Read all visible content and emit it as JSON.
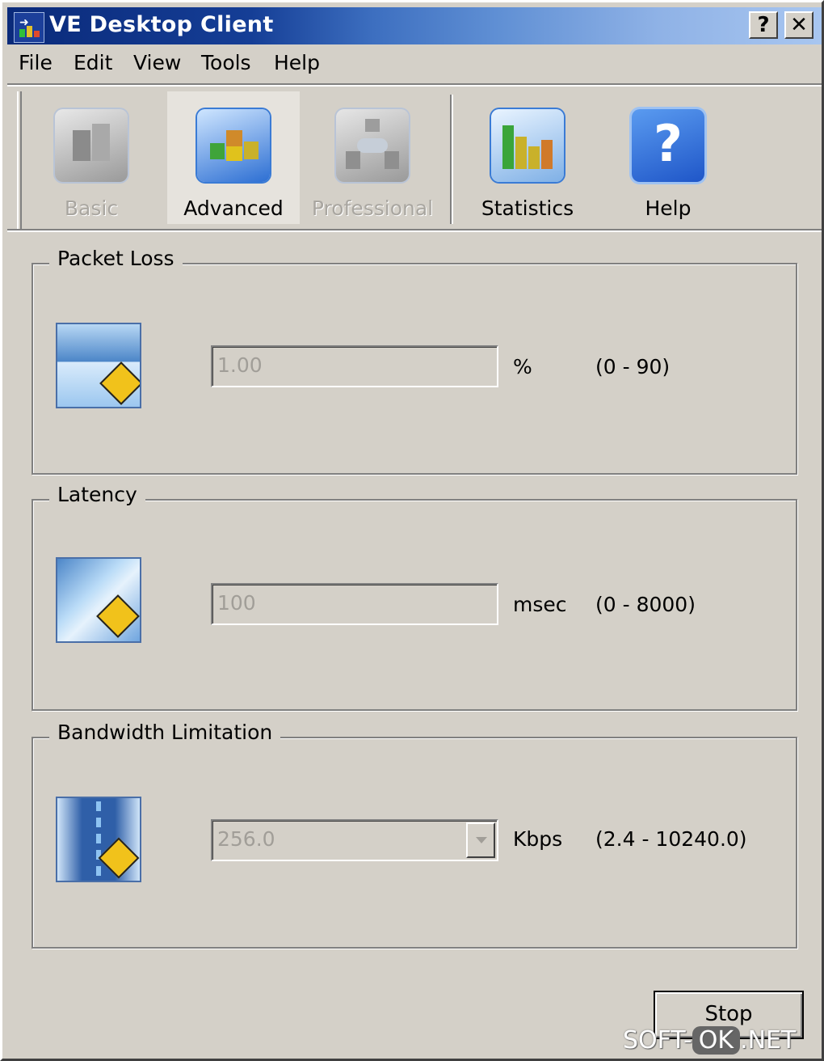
{
  "window": {
    "title": "VE Desktop Client",
    "help_glyph": "?",
    "close_glyph": "✕"
  },
  "menu": [
    "File",
    "Edit",
    "View",
    "Tools",
    "Help"
  ],
  "toolbar": {
    "items": [
      {
        "label": "Basic",
        "icon": "basic-mode-icon",
        "state": "disabled"
      },
      {
        "label": "Advanced",
        "icon": "advanced-mode-icon",
        "state": "selected"
      },
      {
        "label": "Professional",
        "icon": "professional-mode-icon",
        "state": "disabled"
      },
      {
        "label": "Statistics",
        "icon": "statistics-icon",
        "state": "enabled"
      },
      {
        "label": "Help",
        "icon": "help-icon",
        "state": "enabled"
      }
    ]
  },
  "groups": {
    "packet_loss": {
      "title": "Packet Loss",
      "value": "1.00",
      "unit": "%",
      "range": "(0 - 90)",
      "icon": "packet-loss-icon"
    },
    "latency": {
      "title": "Latency",
      "value": "100",
      "unit": "msec",
      "range": "(0 - 8000)",
      "icon": "latency-icon"
    },
    "bandwidth": {
      "title": "Bandwidth Limitation",
      "value": "256.0",
      "unit": "Kbps",
      "range": "(2.4 - 10240.0)",
      "icon": "bandwidth-icon"
    }
  },
  "actions": {
    "stop_label": "Stop"
  },
  "watermark": {
    "left": "SOFT-",
    "mid": "OK",
    "right": ".NET"
  },
  "colors": {
    "title_start": "#0a2a7a",
    "title_end": "#a8c6f0",
    "face": "#d4d0c8",
    "disabled_text": "#a19e98"
  }
}
